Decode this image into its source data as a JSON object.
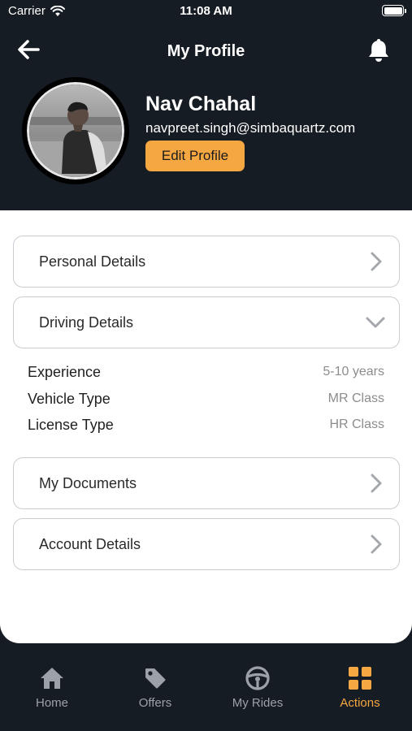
{
  "status_bar": {
    "carrier": "Carrier",
    "time": "11:08 AM"
  },
  "header": {
    "title": "My Profile",
    "back_icon": "arrow-left-icon",
    "notification_icon": "bell-icon"
  },
  "profile": {
    "name": "Nav Chahal",
    "email": "navpreet.singh@simbaquartz.com",
    "edit_label": "Edit Profile"
  },
  "sections": {
    "personal": {
      "label": "Personal Details"
    },
    "driving": {
      "label": "Driving Details",
      "expanded": true,
      "details": [
        {
          "key": "Experience",
          "value": "5-10 years"
        },
        {
          "key": "Vehicle Type",
          "value": "MR Class"
        },
        {
          "key": "License Type",
          "value": "HR Class"
        }
      ]
    },
    "documents": {
      "label": "My Documents"
    },
    "account": {
      "label": "Account Details"
    }
  },
  "tabs": [
    {
      "label": "Home",
      "icon": "home-icon",
      "active": false
    },
    {
      "label": "Offers",
      "icon": "tag-icon",
      "active": false
    },
    {
      "label": "My Rides",
      "icon": "steering-wheel-icon",
      "active": false
    },
    {
      "label": "Actions",
      "icon": "grid-icon",
      "active": true
    }
  ],
  "colors": {
    "dark": "#161c23",
    "accent": "#f5a742",
    "inactive": "#9ca1a8"
  }
}
